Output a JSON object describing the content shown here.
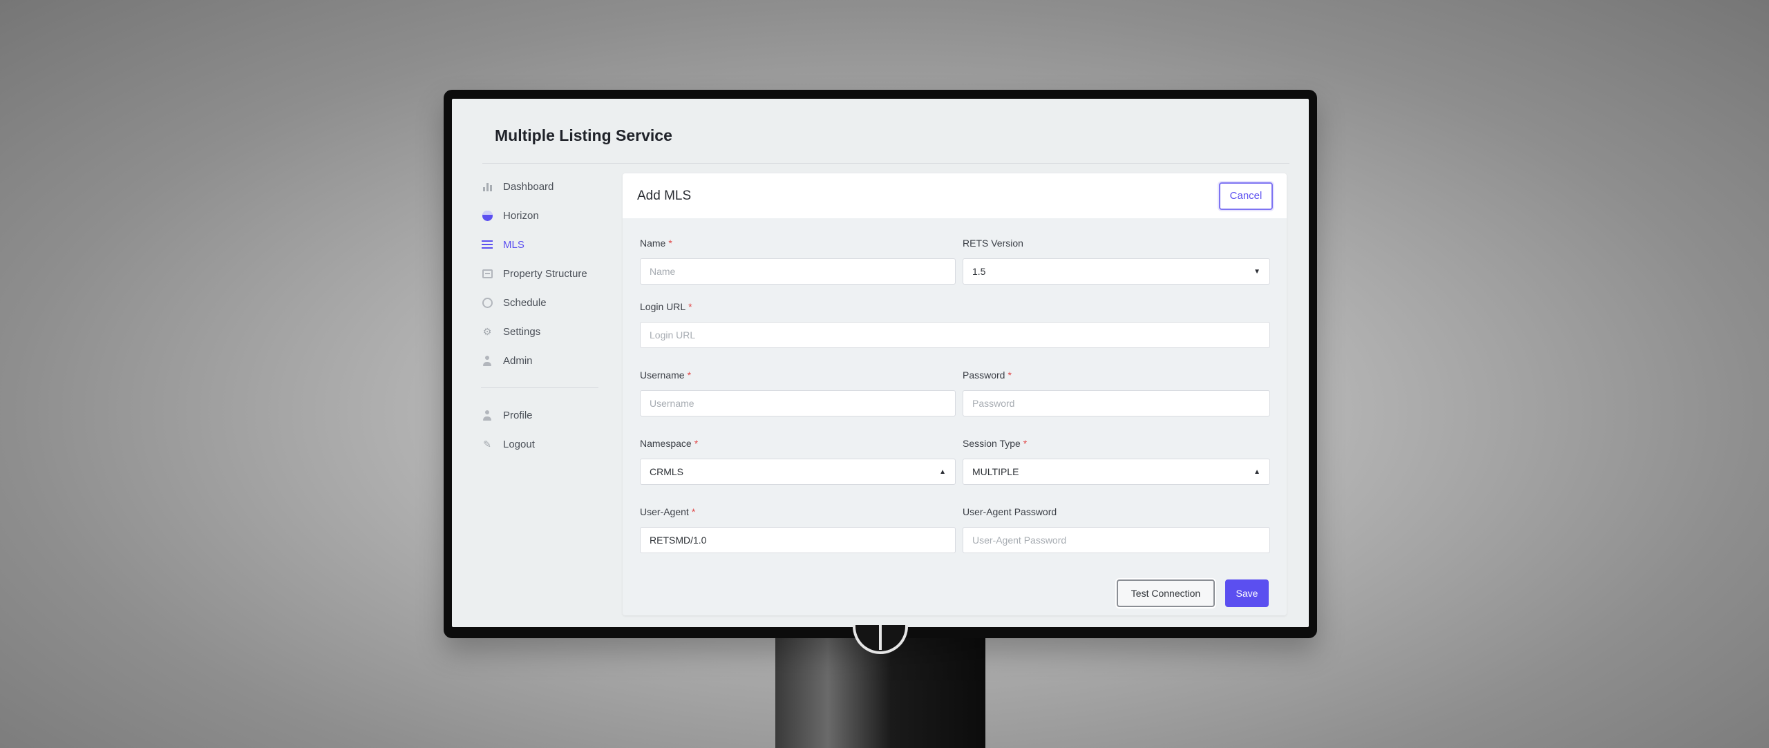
{
  "app": {
    "title": "Multiple Listing Service"
  },
  "sidebar": {
    "items": [
      {
        "label": "Dashboard",
        "icon": "bar-chart-icon"
      },
      {
        "label": "Horizon",
        "icon": "horizon-icon"
      },
      {
        "label": "MLS",
        "icon": "list-icon",
        "active": true
      },
      {
        "label": "Property Structure",
        "icon": "table-icon"
      },
      {
        "label": "Schedule",
        "icon": "clock-icon"
      },
      {
        "label": "Settings",
        "icon": "gear-icon"
      },
      {
        "label": "Admin",
        "icon": "admin-icon"
      }
    ],
    "secondary": [
      {
        "label": "Profile",
        "icon": "user-icon"
      },
      {
        "label": "Logout",
        "icon": "logout-icon"
      }
    ]
  },
  "card": {
    "title": "Add MLS",
    "cancel_label": "Cancel"
  },
  "form": {
    "required_marker": "*",
    "name": {
      "label": "Name",
      "placeholder": "Name",
      "required": true
    },
    "rets_version": {
      "label": "RETS Version",
      "value": "1.5",
      "arrow": "▼"
    },
    "login_url": {
      "label": "Login URL",
      "placeholder": "Login URL",
      "required": true
    },
    "username": {
      "label": "Username",
      "placeholder": "Username",
      "required": true
    },
    "password": {
      "label": "Password",
      "placeholder": "Password",
      "required": true
    },
    "namespace": {
      "label": "Namespace",
      "value": "CRMLS",
      "arrow": "▲",
      "required": true
    },
    "session_type": {
      "label": "Session Type",
      "value": "MULTIPLE",
      "arrow": "▲",
      "required": true
    },
    "user_agent": {
      "label": "User-Agent",
      "value": "RETSMD/1.0",
      "required": true
    },
    "user_agent_password": {
      "label": "User-Agent Password",
      "placeholder": "User-Agent Password"
    }
  },
  "actions": {
    "test_label": "Test Connection",
    "save_label": "Save"
  },
  "colors": {
    "accent": "#5b4ff0",
    "required": "#e04848"
  }
}
